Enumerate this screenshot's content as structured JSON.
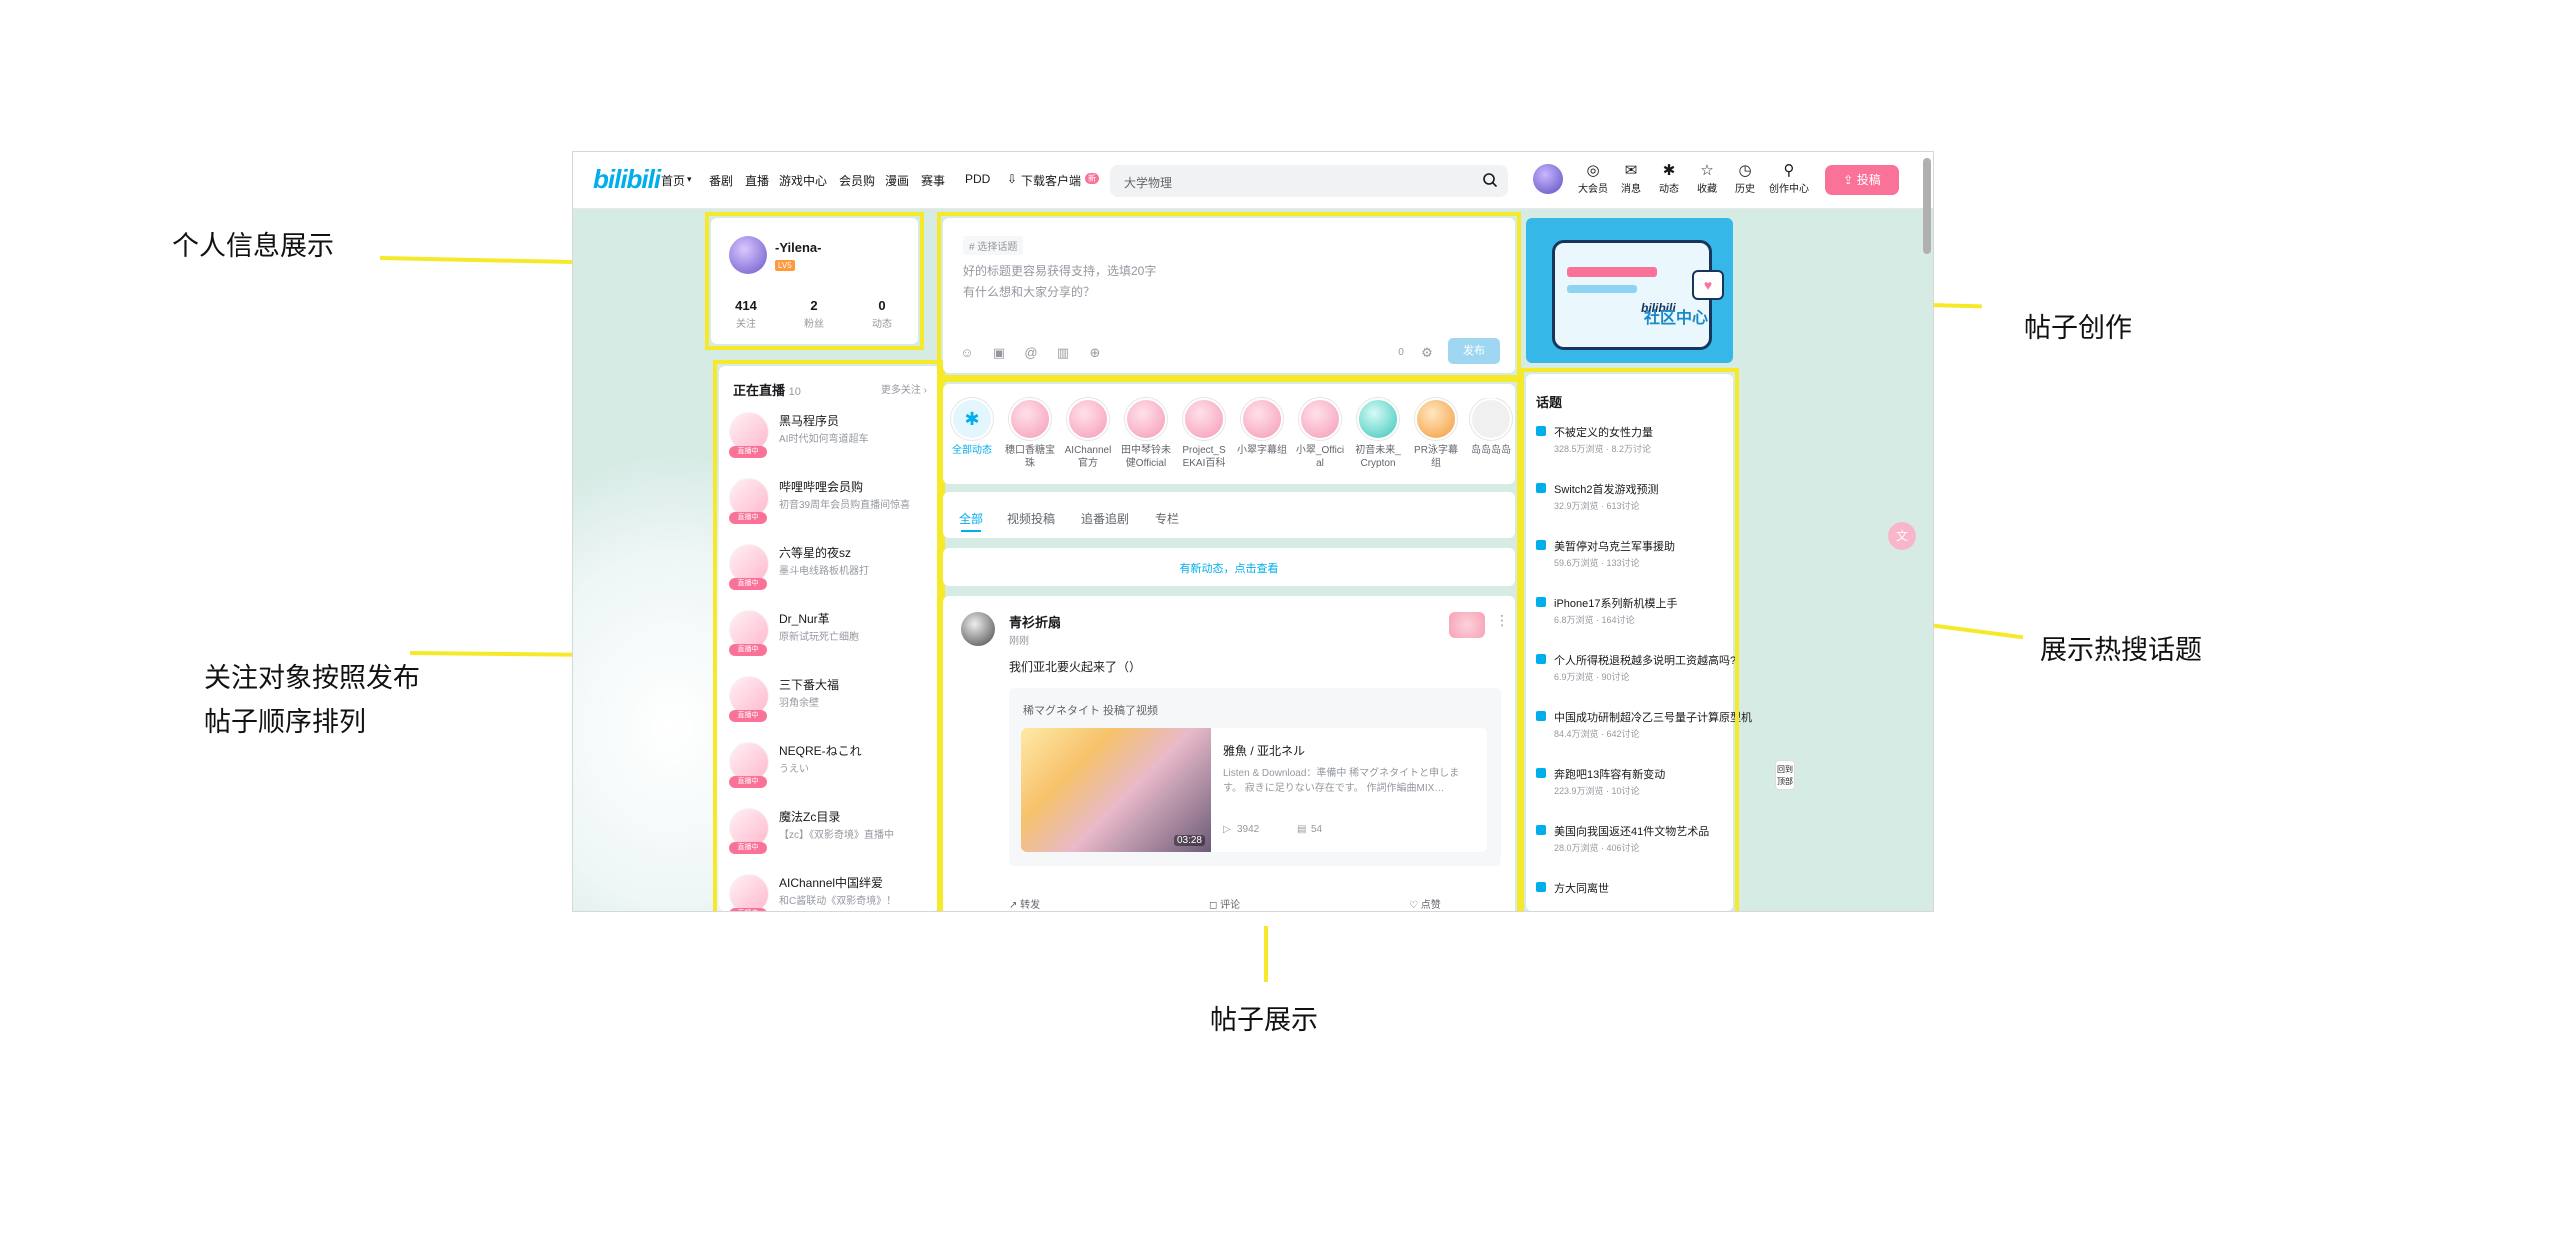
{
  "annotations": {
    "profile": "个人信息展示",
    "following_line1": "关注对象按照发布",
    "following_line2": "帖子顺序排列",
    "post_create": "帖子创作",
    "hot_topics": "展示热搜话题",
    "post_display": "帖子展示"
  },
  "topbar": {
    "logo": "bilibili",
    "nav": [
      "首页",
      "番剧",
      "直播",
      "游戏中心",
      "会员购",
      "漫画",
      "赛事",
      "PDD",
      "下载客户端"
    ],
    "download_badge": "新",
    "search_placeholder": "大学物理",
    "icons": [
      {
        "glyph": "◎",
        "label": "大会员"
      },
      {
        "glyph": "✉",
        "label": "消息"
      },
      {
        "glyph": "✱",
        "label": "动态"
      },
      {
        "glyph": "☆",
        "label": "收藏"
      },
      {
        "glyph": "◷",
        "label": "历史"
      },
      {
        "glyph": "⚲",
        "label": "创作中心"
      }
    ],
    "upload": "投稿"
  },
  "profile": {
    "name": "-Yilena-",
    "level": "LV5",
    "stats": [
      {
        "value": "414",
        "label": "关注"
      },
      {
        "value": "2",
        "label": "粉丝"
      },
      {
        "value": "0",
        "label": "动态"
      }
    ]
  },
  "live": {
    "title": "正在直播",
    "count": "10",
    "more": "更多关注 ›",
    "tag": "直播中",
    "items": [
      {
        "name": "黑马程序员",
        "desc": "AI时代如何弯道超车"
      },
      {
        "name": "哔哩哔哩会员购",
        "desc": "初音39周年会员购直播间惊喜"
      },
      {
        "name": "六等星的夜sz",
        "desc": "墨斗电线路板机器打"
      },
      {
        "name": "Dr_Nur革",
        "desc": "原新试玩死亡细胞"
      },
      {
        "name": "三下番大福",
        "desc": "羽角余壁"
      },
      {
        "name": "NEQRE-ねこれ",
        "desc": "うえい"
      },
      {
        "name": "魔法Zc目录",
        "desc": "【zc】《双影奇境》直播中"
      },
      {
        "name": "AIChannel中国绊爱",
        "desc": "和C酱联动《双影奇境》！"
      }
    ]
  },
  "composer": {
    "topic_chip": "# 选择话题",
    "title_placeholder": "好的标题更容易获得支持，选填20字",
    "body_placeholder": "有什么想和大家分享的？",
    "tools": [
      "☺",
      "▣",
      "@",
      "▥",
      "⊕"
    ],
    "counter": "0",
    "publish": "发布"
  },
  "ups": [
    {
      "name": "全部动态"
    },
    {
      "name": "穗口香糖宝珠"
    },
    {
      "name": "AIChannel官方"
    },
    {
      "name": "田中琴铃未健Official"
    },
    {
      "name": "Project_SEKAI百科站"
    },
    {
      "name": "小翠字幕组"
    },
    {
      "name": "小翠_Official"
    },
    {
      "name": "初音未来_Crypton"
    },
    {
      "name": "PR泳字幕组"
    },
    {
      "name": "岛岛岛岛"
    }
  ],
  "tabs": [
    "全部",
    "视频投稿",
    "追番追剧",
    "专栏"
  ],
  "new_notice": "有新动态，点击查看",
  "feed": {
    "author": "青衫折扇",
    "time": "刚刚",
    "text": "我们亚北要火起来了（）",
    "repost_head": "稀マグネタイト 投稿了视频",
    "video_title": "雅魚 / 亚北ネル",
    "video_desc": "Listen & Download：準備中 稀マグネタイトと申します。 寂きに足りない存在です。 作詞作編曲MIX…",
    "duration": "03:28",
    "plays": "3942",
    "comments": "54",
    "actions": [
      "转发",
      "评论",
      "点赞"
    ]
  },
  "banner": {
    "text": "社区中心",
    "brand": "bilibili"
  },
  "hot": {
    "title": "话题",
    "items": [
      {
        "name": "不被定义的女性力量",
        "meta": "328.5万浏览 · 8.2万讨论"
      },
      {
        "name": "Switch2首发游戏预测",
        "meta": "32.9万浏览 · 613讨论"
      },
      {
        "name": "美暂停对乌克兰军事援助",
        "meta": "59.6万浏览 · 133讨论"
      },
      {
        "name": "iPhone17系列新机模上手",
        "meta": "6.8万浏览 · 164讨论"
      },
      {
        "name": "个人所得税退税越多说明工资越高吗?",
        "meta": "6.9万浏览 · 90讨论"
      },
      {
        "name": "中国成功研制超冷乙三号量子计算原型机",
        "meta": "84.4万浏览 · 642讨论"
      },
      {
        "name": "奔跑吧13阵容有新变动",
        "meta": "223.9万浏览 · 10讨论"
      },
      {
        "name": "美国向我国返还41件文物艺术品",
        "meta": "28.0万浏览 · 406讨论"
      },
      {
        "name": "方大同离世",
        "meta": ""
      }
    ]
  },
  "side_mini": "回到顶部",
  "colors": {
    "accent": "#00aeec",
    "pink": "#fb7299",
    "highlight": "#f5e92a"
  }
}
